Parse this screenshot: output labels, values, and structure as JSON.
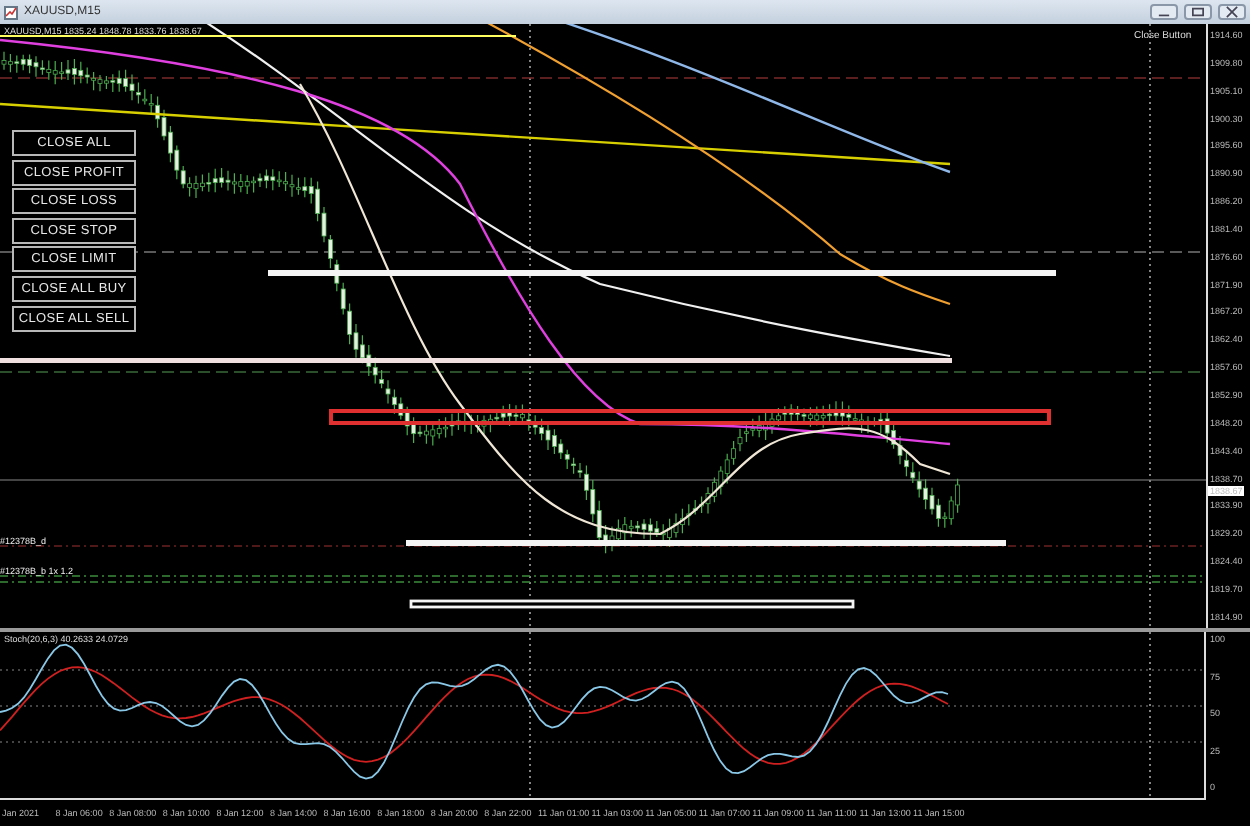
{
  "window": {
    "title": "XAUUSD,M15"
  },
  "chart": {
    "header": "XAUUSD,M15  1835.24 1848.78 1833.76 1838.67",
    "indicator_label": "Close Button",
    "order_labels": [
      "#12378B_d",
      "#12378B_b 1x 1.2"
    ],
    "price_axis": [
      "1914.60",
      "1909.80",
      "1905.10",
      "1900.30",
      "1895.60",
      "1890.90",
      "1886.20",
      "1881.40",
      "1876.60",
      "1871.90",
      "1867.20",
      "1862.40",
      "1857.60",
      "1852.90",
      "1848.20",
      "1843.40",
      "1838.70",
      "1833.90",
      "1829.20",
      "1824.40",
      "1819.70",
      "1814.90"
    ],
    "current_price": "1838.67"
  },
  "buttons": [
    {
      "label": "CLOSE ALL"
    },
    {
      "label": "CLOSE PROFIT"
    },
    {
      "label": "CLOSE LOSS"
    },
    {
      "label": "CLOSE STOP"
    },
    {
      "label": "CLOSE LIMIT"
    },
    {
      "label": "CLOSE ALL BUY"
    },
    {
      "label": "CLOSE ALL SELL"
    }
  ],
  "oscillator": {
    "header": "Stoch(20,6,3) 40.2633 24.0729",
    "axis": [
      "100",
      "75",
      "50",
      "25",
      "0"
    ]
  },
  "time_axis": [
    "Jan 2021",
    "8 Jan 06:00",
    "8 Jan 08:00",
    "8 Jan 10:00",
    "8 Jan 12:00",
    "8 Jan 14:00",
    "8 Jan 16:00",
    "8 Jan 18:00",
    "8 Jan 20:00",
    "8 Jan 22:00",
    "11 Jan 01:00",
    "11 Jan 03:00",
    "11 Jan 05:00",
    "11 Jan 07:00",
    "11 Jan 09:00",
    "11 Jan 11:00",
    "11 Jan 13:00",
    "11 Jan 15:00"
  ]
}
